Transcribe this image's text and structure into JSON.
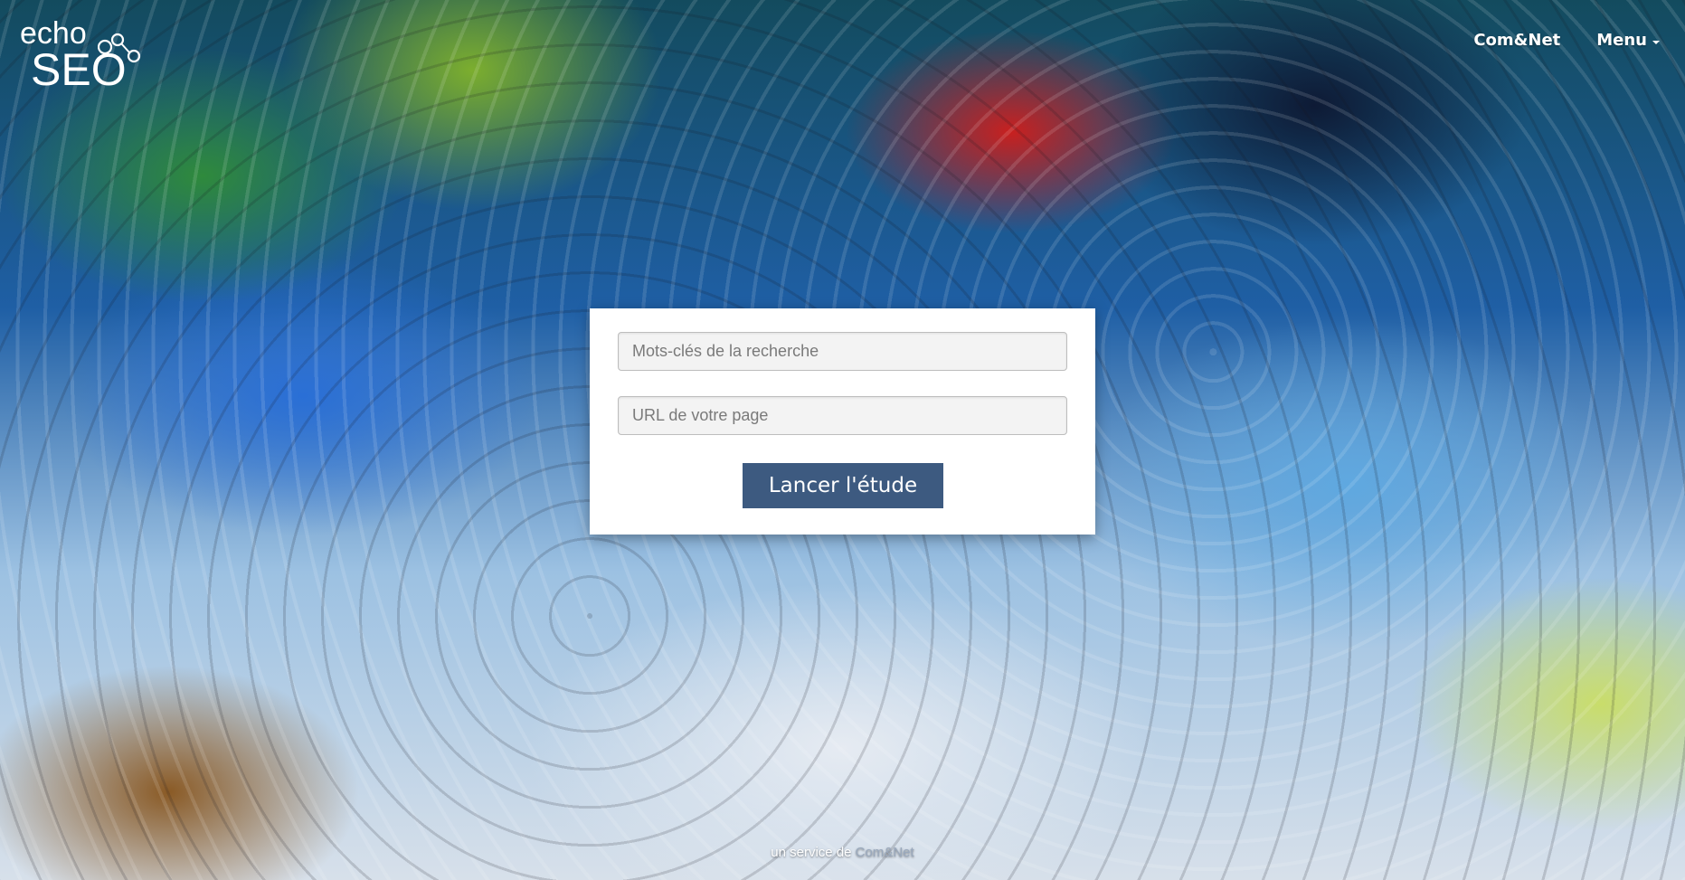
{
  "brand": {
    "logo_top": "echo",
    "logo_bottom": "SEO"
  },
  "nav": {
    "items": [
      {
        "label": "Com&Net"
      },
      {
        "label": "Menu",
        "has_caret": true
      }
    ]
  },
  "form": {
    "keywords_placeholder": "Mots-clés de la recherche",
    "keywords_value": "",
    "url_placeholder": "URL de votre page",
    "url_value": "",
    "submit_label": "Lancer l'étude",
    "submit_color": "#3d5a80"
  },
  "footer": {
    "prefix": "un service de",
    "link": "Com&Net"
  }
}
